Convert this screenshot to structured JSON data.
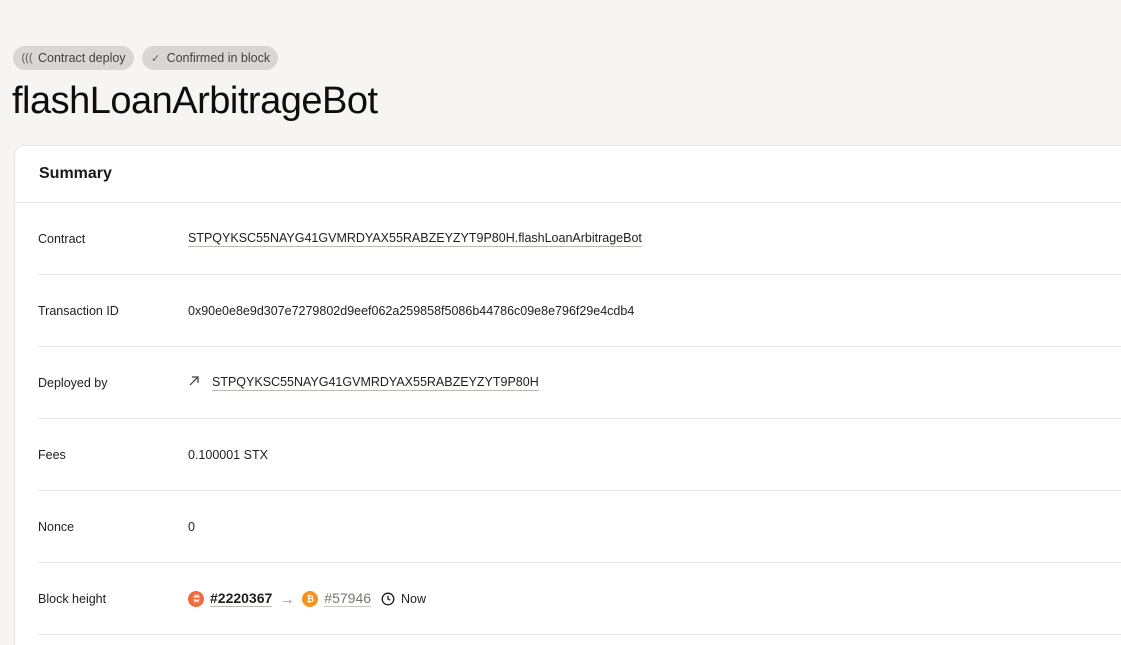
{
  "badges": [
    {
      "icon": "signal-waves-icon",
      "glyph": "(((",
      "label": "Contract deploy"
    },
    {
      "icon": "check-icon",
      "glyph": "✓",
      "label": "Confirmed in block"
    }
  ],
  "page_title": "flashLoanArbitrageBot",
  "summary": {
    "title": "Summary",
    "contract": {
      "label": "Contract",
      "value": "STPQYKSC55NAYG41GVMRDYAX55RABZEYZYT9P80H.flashLoanArbitrageBot"
    },
    "transaction_id": {
      "label": "Transaction ID",
      "value": "0x90e0e8e9d307e7279802d9eef062a259858f5086b44786c09e8e796f29e4cdb4"
    },
    "deployed_by": {
      "label": "Deployed by",
      "icon": "arrow-up-right-icon",
      "value": "STPQYKSC55NAYG41GVMRDYAX55RABZEYZYT9P80H"
    },
    "fees": {
      "label": "Fees",
      "value": "0.100001 STX"
    },
    "nonce": {
      "label": "Nonce",
      "value": "0"
    },
    "block_height": {
      "label": "Block height",
      "stacks_block": "#2220367",
      "bitcoin_block": "#57946",
      "time": "Now"
    }
  },
  "colors": {
    "background": "#f6f5f3",
    "stacks_orange": "#f06a3a",
    "bitcoin_orange": "#f7931a",
    "badge_bg": "#d9d7d3"
  }
}
